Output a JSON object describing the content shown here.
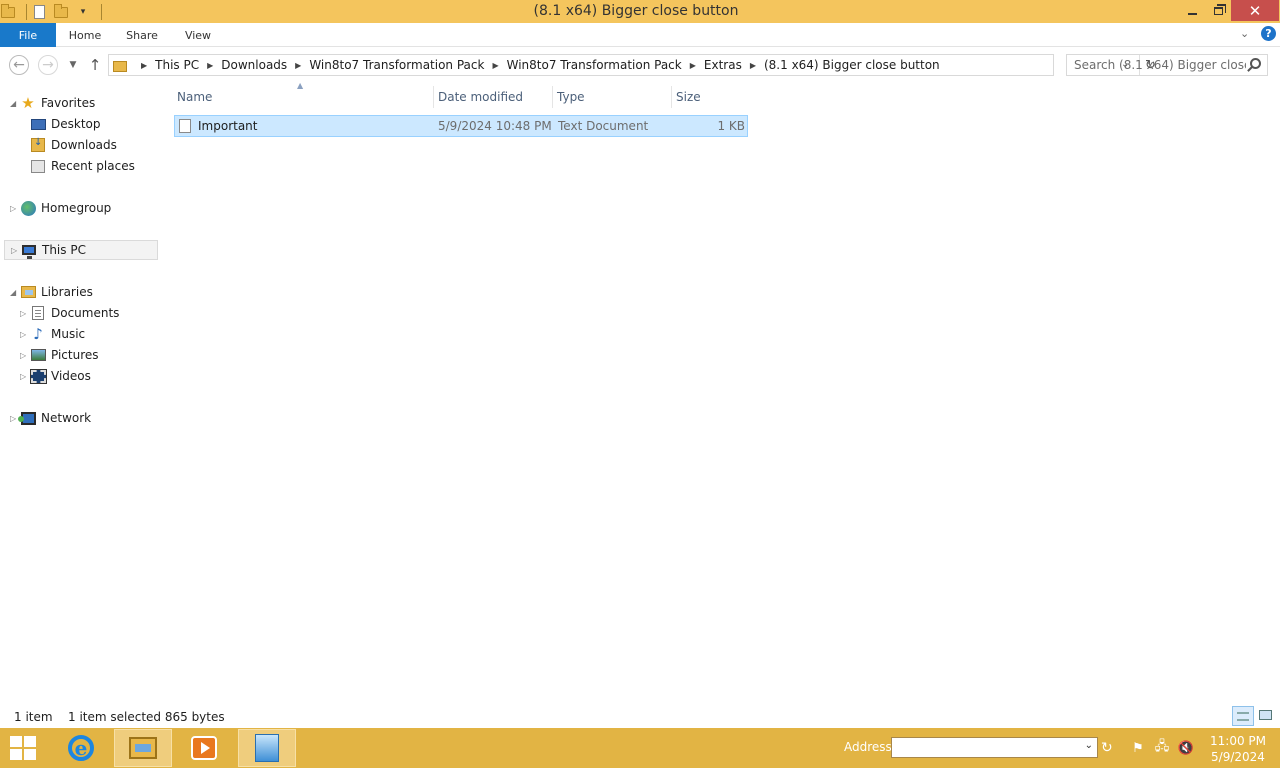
{
  "window": {
    "title": "(8.1 x64) Bigger close button",
    "minimize_icon": "minimize-icon",
    "restore_icon": "restore-icon",
    "close_glyph": "✕"
  },
  "ribbon": {
    "tabs": [
      "File",
      "Home",
      "Share",
      "View"
    ],
    "help_glyph": "?"
  },
  "address": {
    "breadcrumbs": [
      "This PC",
      "Downloads",
      "Win8to7 Transformation Pack",
      "Win8to7 Transformation Pack",
      "Extras",
      "(8.1 x64) Bigger close button"
    ]
  },
  "search": {
    "placeholder": "Search (8.1 x64) Bigger close b..."
  },
  "navpane": {
    "favorites": "Favorites",
    "desktop": "Desktop",
    "downloads": "Downloads",
    "recent_places": "Recent places",
    "homegroup": "Homegroup",
    "this_pc": "This PC",
    "libraries": "Libraries",
    "documents": "Documents",
    "music": "Music",
    "pictures": "Pictures",
    "videos": "Videos",
    "network": "Network"
  },
  "columns": {
    "name": "Name",
    "date_modified": "Date modified",
    "type": "Type",
    "size": "Size"
  },
  "files": [
    {
      "name": "Important",
      "date_modified": "5/9/2024 10:48 PM",
      "type": "Text Document",
      "size": "1 KB"
    }
  ],
  "status": {
    "item_count": "1 item",
    "selection": "1 item selected  865 bytes"
  },
  "taskbar": {
    "address_label": "Address",
    "address_value": "",
    "time": "11:00 PM",
    "date": "5/9/2024"
  },
  "colors": {
    "titlebar": "#f4c55d",
    "taskbar": "#e2b444",
    "file_tab": "#1979ca",
    "close_button": "#c74f4c",
    "selection": "#cce8ff"
  }
}
